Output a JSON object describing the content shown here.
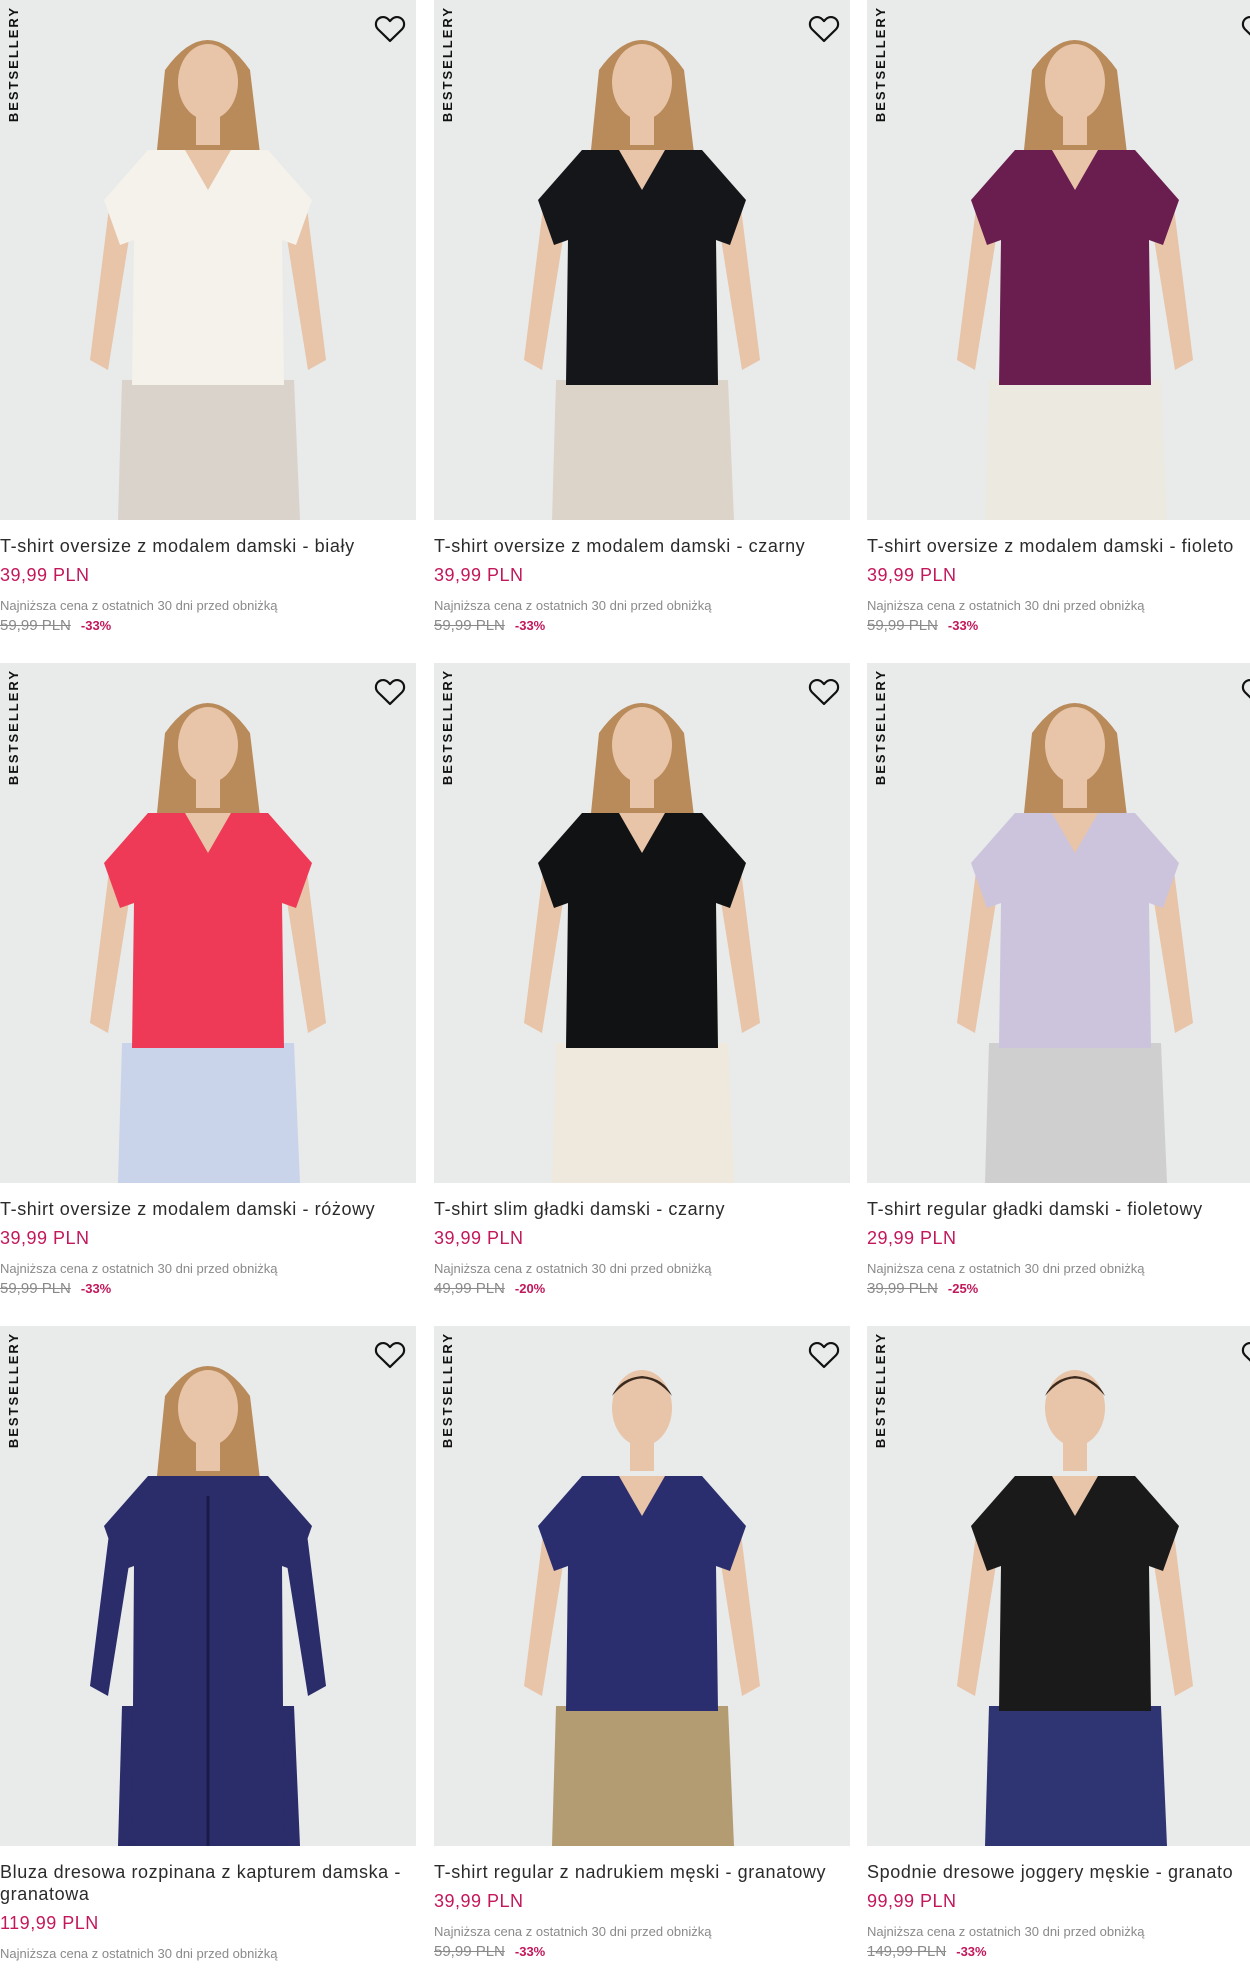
{
  "badge_text": "BESTSELLERY",
  "colors": {
    "accent": "#c2185b",
    "photo_bg": "#e9eaea"
  },
  "icons": {
    "wishlist": "heart-outline-icon"
  },
  "lowest_price_note": "Najniższa cena z ostatnich 30 dni przed obniżką",
  "products": [
    {
      "title": "T-shirt oversize z modalem damski - biały",
      "price": "39,99 PLN",
      "old_price": "59,99 PLN",
      "discount": "-33%",
      "shirt_color": "#f4f2ea",
      "bottom_color": "#d9d3cb"
    },
    {
      "title": "T-shirt oversize z modalem damski - czarny",
      "price": "39,99 PLN",
      "old_price": "59,99 PLN",
      "discount": "-33%",
      "shirt_color": "#15161a",
      "bottom_color": "#dcd4c8"
    },
    {
      "title": "T-shirt oversize z modalem damski - fioleto",
      "price": "39,99 PLN",
      "old_price": "59,99 PLN",
      "discount": "-33%",
      "shirt_color": "#6a1d4f",
      "bottom_color": "#ece9e1"
    },
    {
      "title": "T-shirt oversize z modalem damski - różowy",
      "price": "39,99 PLN",
      "old_price": "59,99 PLN",
      "discount": "-33%",
      "shirt_color": "#ee3a57",
      "bottom_color": "#c9d4ea"
    },
    {
      "title": "T-shirt slim gładki damski - czarny",
      "price": "39,99 PLN",
      "old_price": "49,99 PLN",
      "discount": "-20%",
      "shirt_color": "#111214",
      "bottom_color": "#efe9dd"
    },
    {
      "title": "T-shirt regular gładki damski - fioletowy",
      "price": "29,99 PLN",
      "old_price": "39,99 PLN",
      "discount": "-25%",
      "shirt_color": "#ccc4dd",
      "bottom_color": "#cfcfcf"
    },
    {
      "title": "Bluza dresowa rozpinana z kapturem damska - granatowa",
      "price": "119,99 PLN",
      "old_price": "",
      "discount": "",
      "shirt_color": "#2b2c6a",
      "bottom_color": "#2b2c6a"
    },
    {
      "title": "T-shirt regular z nadrukiem męski - granatowy",
      "price": "39,99 PLN",
      "old_price": "59,99 PLN",
      "discount": "-33%",
      "shirt_color": "#2a2e6e",
      "bottom_color": "#b39c72"
    },
    {
      "title": "Spodnie dresowe joggery męskie - granato",
      "price": "99,99 PLN",
      "old_price": "149,99 PLN",
      "discount": "-33%",
      "shirt_color": "#1a1a1a",
      "bottom_color": "#2f3473"
    }
  ]
}
